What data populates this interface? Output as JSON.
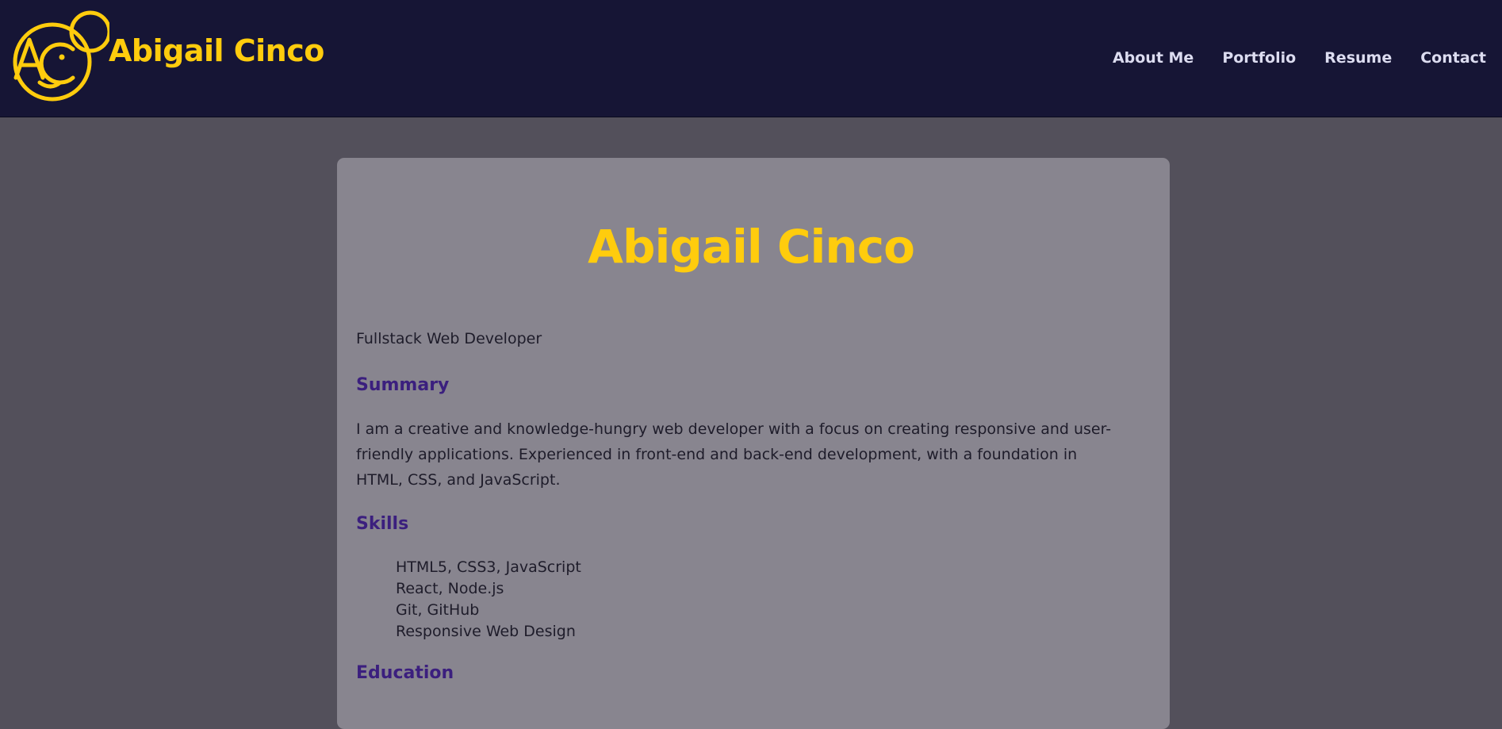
{
  "header": {
    "brand_name": "Abigail Cinco",
    "logo_icon": "ac-smiley-logo-icon",
    "nav": [
      {
        "label": "About Me"
      },
      {
        "label": "Portfolio"
      },
      {
        "label": "Resume"
      },
      {
        "label": "Contact"
      }
    ]
  },
  "resume": {
    "name": "Abigail Cinco",
    "tagline": "Fullstack Web Developer",
    "summary_heading": "Summary",
    "summary_text": "I am a creative and knowledge-hungry web developer with a focus on creating responsive and user-friendly applications. Experienced in front-end and back-end development, with a foundation in HTML, CSS, and JavaScript.",
    "skills_heading": "Skills",
    "skills": [
      "HTML5, CSS3, JavaScript",
      "React, Node.js",
      "Git, GitHub",
      "Responsive Web Design"
    ],
    "education_heading": "Education"
  },
  "colors": {
    "navbar_bg": "#161535",
    "page_bg": "#53505b",
    "card_bg": "#88858f",
    "accent_yellow": "#ffcc0d",
    "heading_purple": "#3b1f7e",
    "nav_text": "#dcdcf0"
  }
}
